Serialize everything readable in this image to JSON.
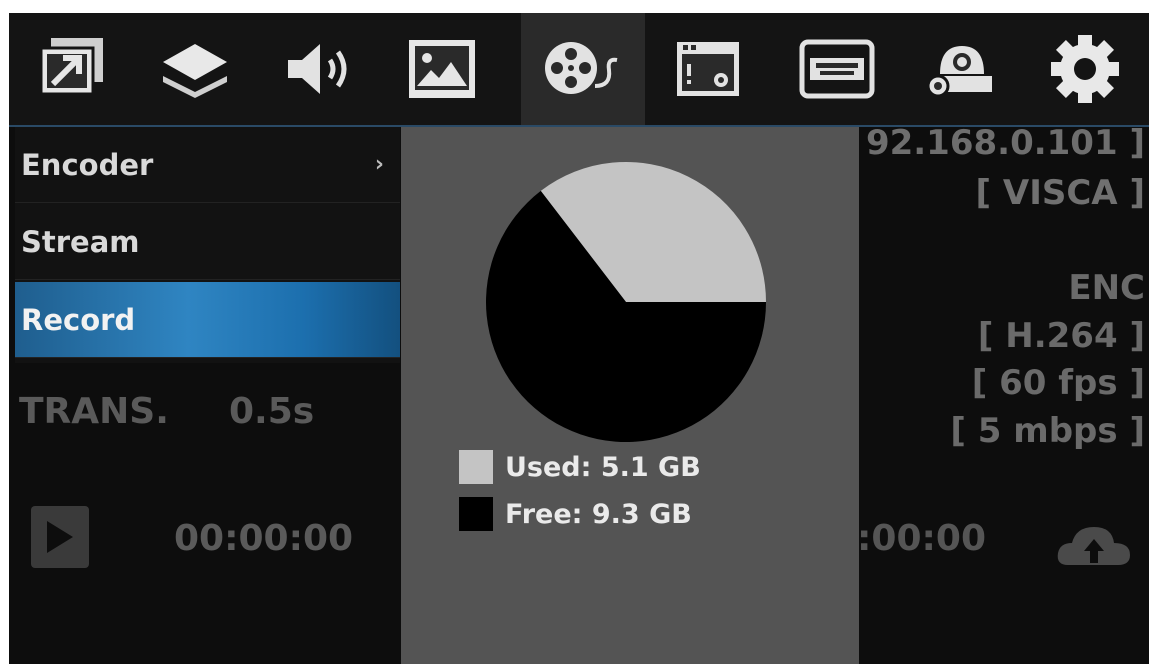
{
  "toolbar": {
    "icons": [
      "external-window-icon",
      "layers-icon",
      "speaker-icon",
      "image-icon",
      "film-reel-icon",
      "window-settings-icon",
      "hdmi-icon",
      "camera-settings-icon",
      "gear-icon"
    ],
    "active_index": 4
  },
  "menu": {
    "items": [
      {
        "label": "Encoder",
        "has_submenu": true
      },
      {
        "label": "Stream"
      },
      {
        "label": "Record"
      }
    ],
    "selected": "Record",
    "submenu_glyph": "›"
  },
  "background": {
    "trans_label": "TRANS.",
    "trans_value": "0.5s",
    "time_left": "00:00:00",
    "time_right": ":00:00",
    "ip_partial": "92.168.0.101 ]",
    "protocol": "[ VISCA ]",
    "enc_label": "ENC",
    "codec": "[ H.264 ]",
    "fps": "[ 60 fps ]",
    "bitrate": "[ 5 mbps ]"
  },
  "storage": {
    "used_label": "Used: 5.1 GB",
    "free_label": "Free:  9.3 GB",
    "used_gb": 5.1,
    "free_gb": 9.3,
    "used_color": "#c4c4c4",
    "free_color": "#000000"
  }
}
